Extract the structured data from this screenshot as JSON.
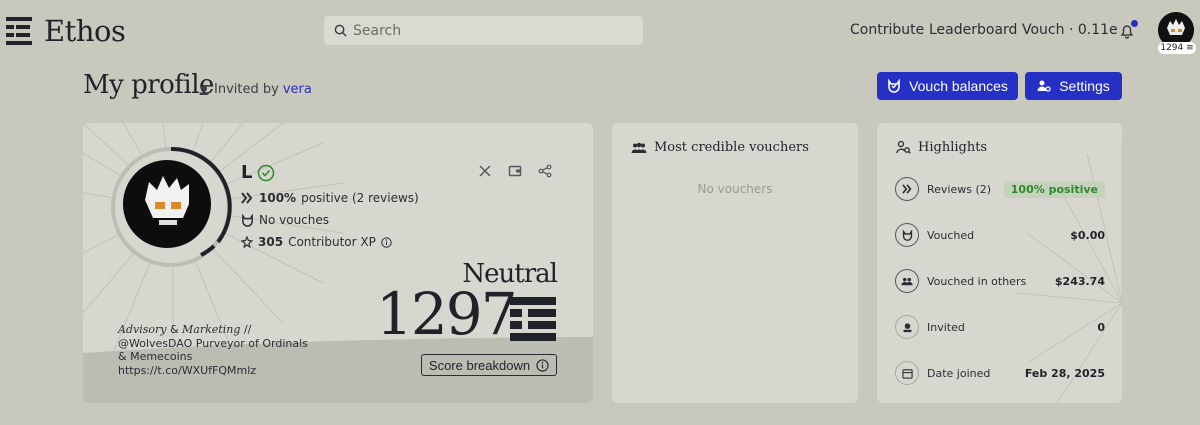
{
  "nav": {
    "logo_text": "Ethos",
    "search_placeholder": "Search",
    "links": [
      "Contribute",
      "Leaderboard",
      "Vouch · 0.11e"
    ],
    "avatar_badge": "1294"
  },
  "header": {
    "title": "My profile",
    "invited_prefix": "Invited by",
    "invited_name": "vera",
    "vouch_balances_label": "Vouch balances",
    "settings_label": "Settings"
  },
  "profile": {
    "name": "L",
    "reviews_positive": "100%",
    "reviews_text": "positive (2 reviews)",
    "vouches_text": "No vouches",
    "xp_value": "305",
    "xp_text": "Contributor XP",
    "level": "Neutral",
    "score": "1297",
    "score_breakdown_label": "Score breakdown",
    "bio_title": "Advisory",
    "bio_amp": "&",
    "bio_title2": "Marketing",
    "bio_sep": "//",
    "bio_line2": "@WolvesDAO Purveyor of Ordinals",
    "bio_line3": "& Memecoins",
    "bio_line4": "https://t.co/WXUfFQMmlz"
  },
  "vouchers": {
    "title": "Most credible vouchers",
    "empty": "No vouchers"
  },
  "highlights": {
    "title": "Highlights",
    "rows": [
      {
        "label": "Reviews (2)",
        "value": "100% positive"
      },
      {
        "label": "Vouched",
        "value": "$0.00"
      },
      {
        "label": "Vouched in others",
        "value": "$243.74"
      },
      {
        "label": "Invited",
        "value": "0"
      },
      {
        "label": "Date joined",
        "value": "Feb 28, 2025"
      }
    ]
  },
  "colors": {
    "accent": "#2530c4",
    "background": "#c9c8bd",
    "card": "#d8d7cf",
    "positive": "#2f8a2a"
  }
}
